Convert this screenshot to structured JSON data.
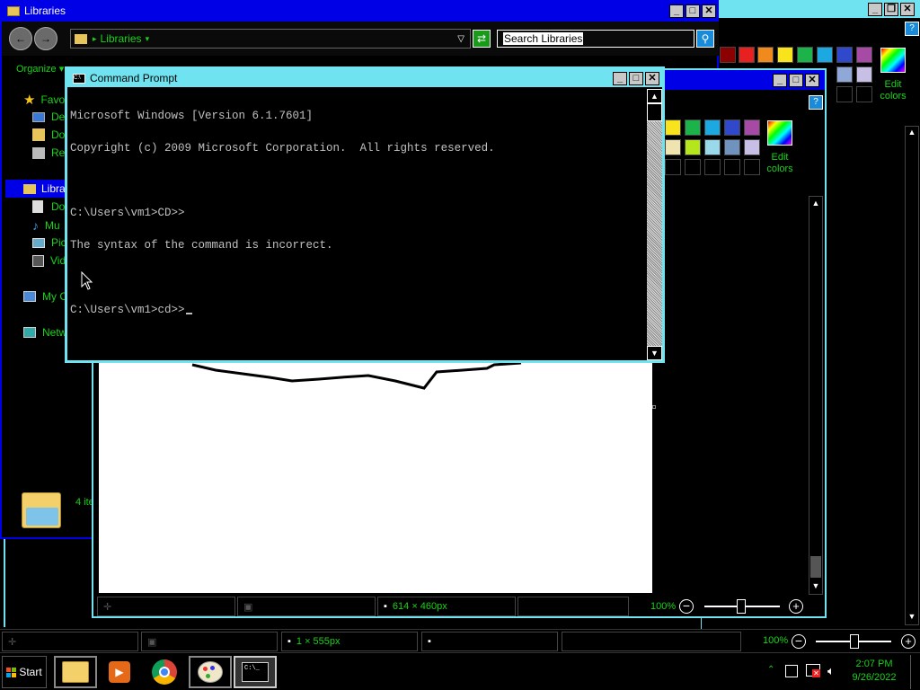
{
  "explorer": {
    "title": "Libraries",
    "address": "Libraries",
    "search_placeholder": "Search Libraries",
    "organize": "Organize",
    "nav": [
      {
        "label": "Favo",
        "icon": "star-icon"
      },
      {
        "label": "De",
        "icon": "desktop-icon"
      },
      {
        "label": "Do",
        "icon": "downloads-icon"
      },
      {
        "label": "Re",
        "icon": "recent-places-icon"
      },
      {
        "label": "Libra",
        "icon": "libraries-icon"
      },
      {
        "label": "Do",
        "icon": "documents-icon"
      },
      {
        "label": "Mu",
        "icon": "music-icon"
      },
      {
        "label": "Pic",
        "icon": "pictures-icon"
      },
      {
        "label": "Vid",
        "icon": "videos-icon"
      },
      {
        "label": "My C",
        "icon": "computer-icon"
      },
      {
        "label": "Netw",
        "icon": "network-icon"
      }
    ],
    "items_count": "4 ite"
  },
  "cmd": {
    "title": "Command Prompt",
    "lines": [
      "Microsoft Windows [Version 6.1.7601]",
      "Copyright (c) 2009 Microsoft Corporation.  All rights reserved.",
      "",
      "C:\\Users\\vm1>CD>>",
      "The syntax of the command is incorrect.",
      "",
      "C:\\Users\\vm1>cd>>"
    ]
  },
  "paint_front": {
    "edit_colors": "Edit colors",
    "status_size": "614 × 460px",
    "zoom": "100%"
  },
  "paint_back": {
    "edit_colors": "Edit colors",
    "status_size": "1 × 555px",
    "zoom": "100%"
  },
  "taskbar": {
    "start": "Start",
    "time": "2:07 PM",
    "date": "9/26/2022",
    "apps": [
      "explorer-icon",
      "media-player-icon",
      "chrome-icon",
      "paint-icon",
      "cmd-icon"
    ]
  },
  "colors": {
    "accent_green": "#18d418",
    "title_blue": "#0000e6",
    "cmd_title_cyan": "#6fe3ef"
  }
}
